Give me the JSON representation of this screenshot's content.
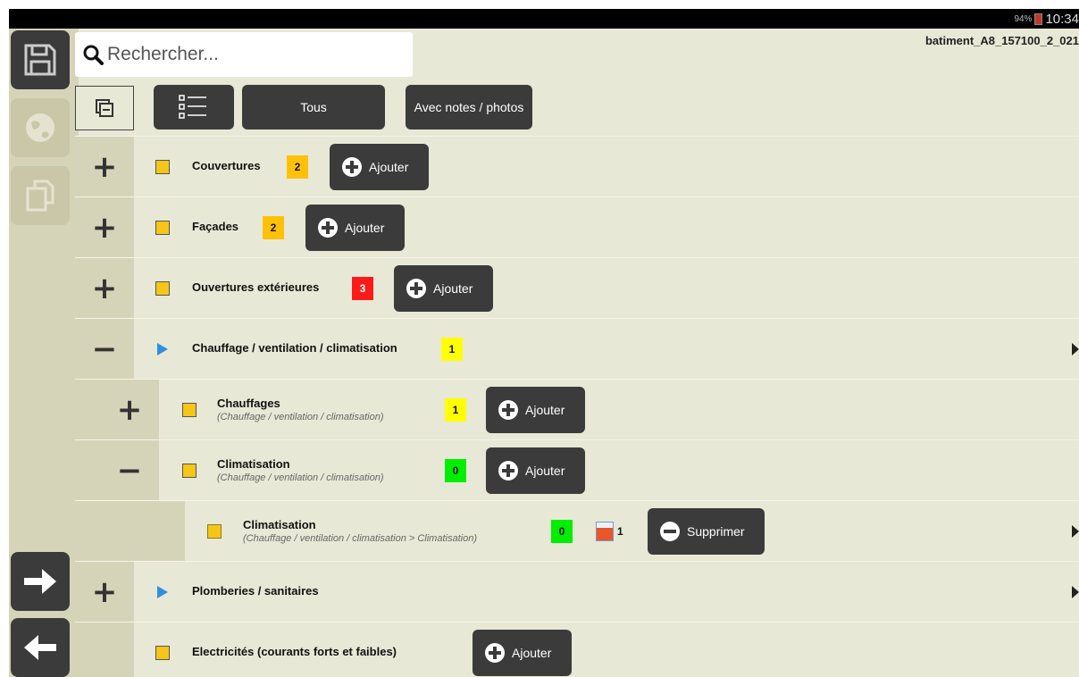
{
  "status_bar": {
    "battery": "94%",
    "time": "10:34"
  },
  "header": {
    "search_placeholder": "Rechercher...",
    "filename": "batiment_A8_157100_2_021"
  },
  "toolbar": {
    "all_label": "Tous",
    "notes_label": "Avec notes / photos"
  },
  "sidebar": {
    "icons": [
      "save-icon",
      "globe-icon",
      "copy-icon",
      "arrow-right-icon",
      "arrow-left-icon"
    ]
  },
  "colors": {
    "badge_yellow": "#ffff00",
    "badge_amber": "#ffc107",
    "badge_red": "#ff1a1a",
    "badge_green": "#00ee00",
    "accent_dark": "#3b3b3b",
    "background": "#e8e8d6"
  },
  "rows": [
    {
      "expander": "+",
      "icon": "edit-icon",
      "title": "Couvertures",
      "badge": "2",
      "action": "Ajouter"
    },
    {
      "expander": "+",
      "icon": "edit-icon",
      "title": "Façades",
      "badge": "2",
      "action": "Ajouter"
    },
    {
      "expander": "+",
      "icon": "edit-icon",
      "title": "Ouvertures extérieures",
      "badge": "3",
      "action": "Ajouter"
    },
    {
      "expander": "−",
      "icon": "play-icon",
      "title": "Chauffage / ventilation / climatisation",
      "badge": "1"
    },
    {
      "expander": "+",
      "icon": "edit-icon",
      "title": "Chauffages",
      "subtitle": "(Chauffage / ventilation / climatisation)",
      "badge": "1",
      "action": "Ajouter"
    },
    {
      "expander": "−",
      "icon": "edit-icon",
      "title": "Climatisation",
      "subtitle": "(Chauffage / ventilation / climatisation)",
      "badge": "0",
      "action": "Ajouter"
    },
    {
      "icon": "square-icon",
      "title": "Climatisation",
      "subtitle": "(Chauffage / ventilation / climatisation > Climatisation)",
      "badge": "0",
      "photo_count": "1",
      "action": "Supprimer"
    },
    {
      "expander": "+",
      "icon": "play-icon",
      "title": "Plomberies / sanitaires"
    },
    {
      "icon": "edit-icon",
      "title": "Electricités (courants forts et faibles)",
      "action": "Ajouter"
    }
  ]
}
